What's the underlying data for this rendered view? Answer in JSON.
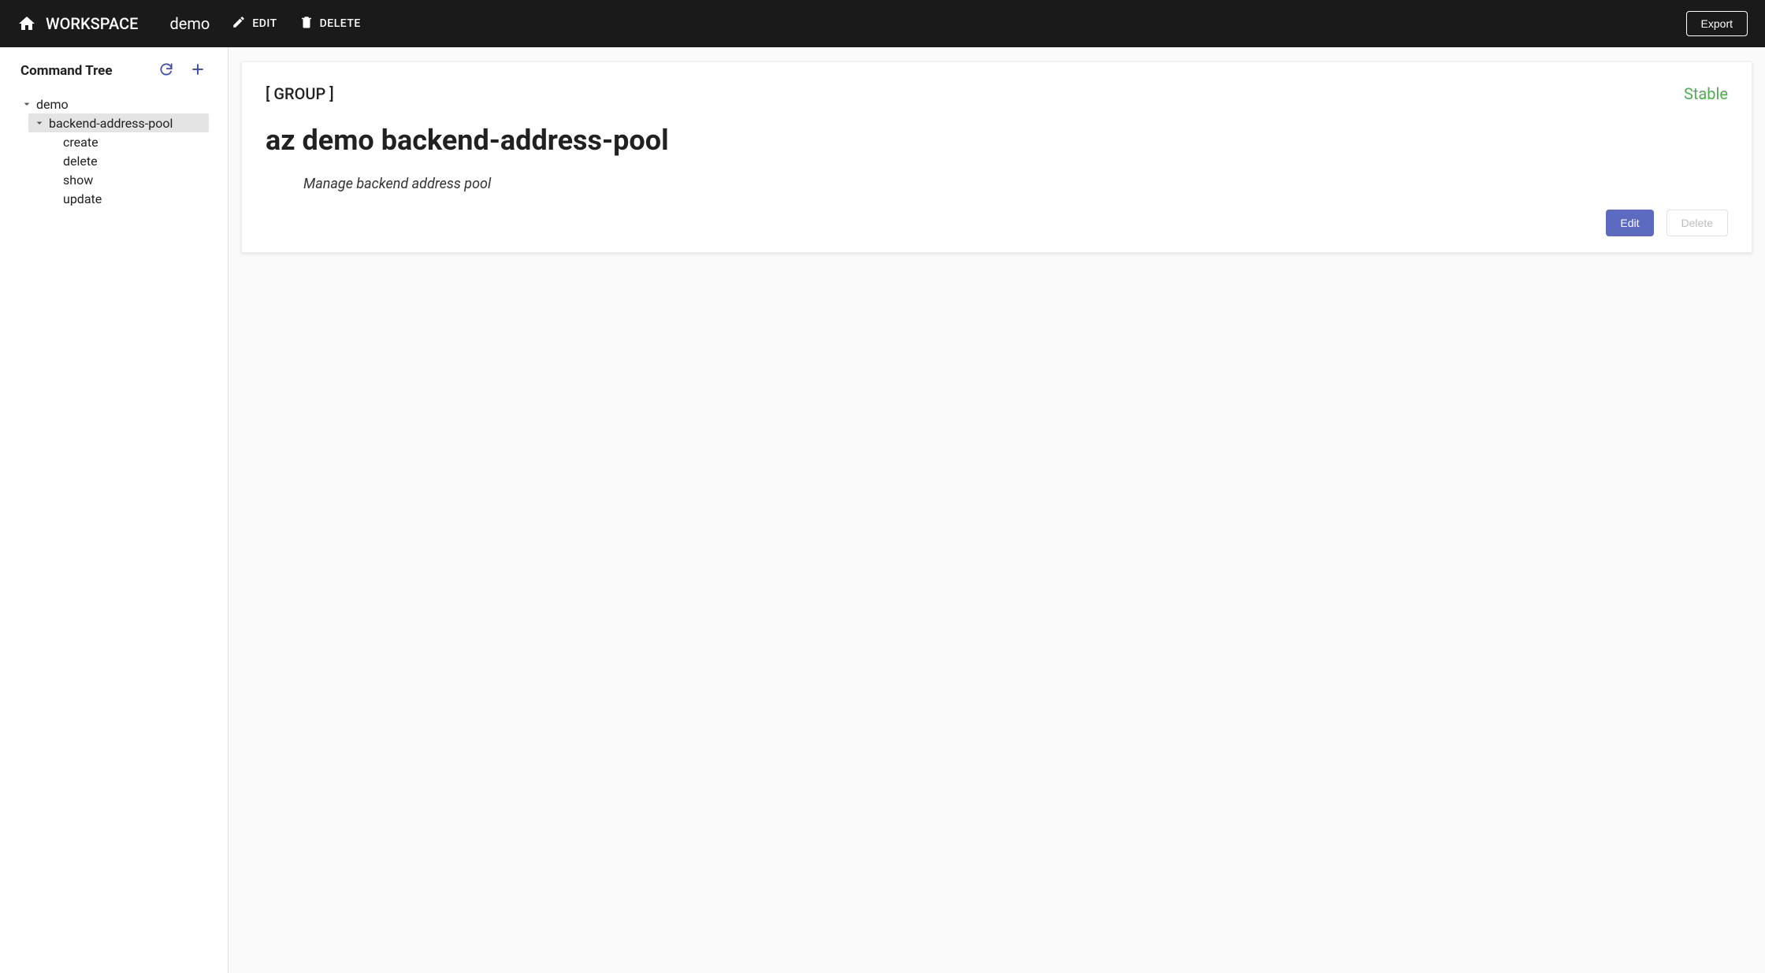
{
  "appbar": {
    "workspace_label": "WORKSPACE",
    "workspace_name": "demo",
    "edit_label": "EDIT",
    "delete_label": "DELETE",
    "export_label": "Export"
  },
  "sidebar": {
    "title": "Command Tree",
    "root": {
      "label": "demo",
      "children": [
        {
          "label": "backend-address-pool",
          "children": [
            {
              "label": "create"
            },
            {
              "label": "delete"
            },
            {
              "label": "show"
            },
            {
              "label": "update"
            }
          ]
        }
      ]
    }
  },
  "detail": {
    "group_tag": "[ GROUP ]",
    "status": "Stable",
    "title": "az demo backend-address-pool",
    "description": "Manage backend address pool",
    "edit_label": "Edit",
    "delete_label": "Delete"
  }
}
